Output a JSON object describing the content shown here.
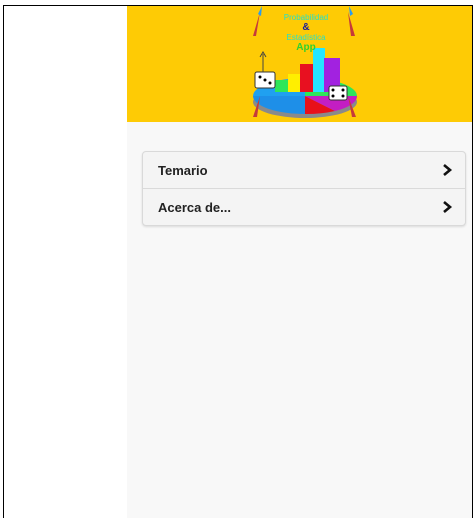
{
  "banner": {
    "logo_lines": [
      "Probabilidad",
      "&",
      "Estadística",
      "App"
    ],
    "logo_colors": [
      "#27e0c8",
      "#1a1a9a",
      "#27e0c8",
      "#2fd12f"
    ],
    "background": "#fecb05"
  },
  "menu": {
    "items": [
      {
        "label": "Temario",
        "icon": "chevron-right-icon"
      },
      {
        "label": "Acerca de...",
        "icon": "chevron-right-icon"
      }
    ]
  }
}
